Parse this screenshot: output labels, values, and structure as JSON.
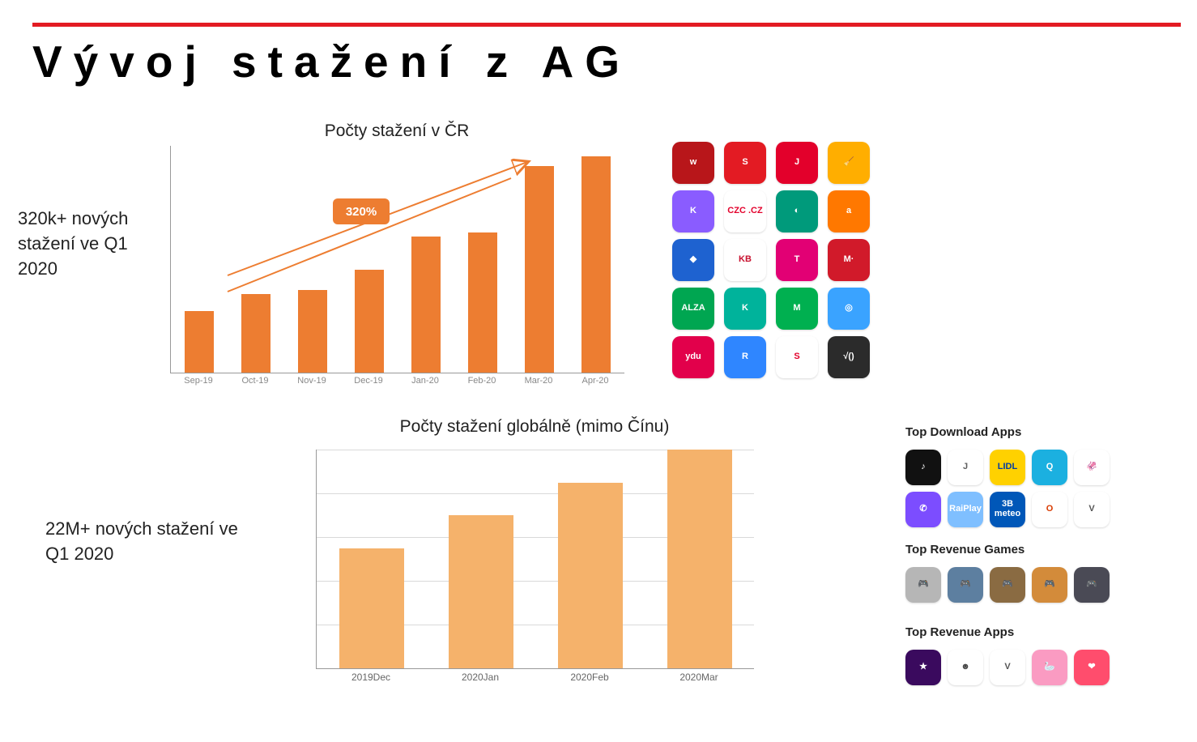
{
  "title": "Vývoj stažení z AG",
  "note1": "320k+ nových stažení ve Q1 2020",
  "note2": "22M+ nových stažení ve Q1 2020",
  "arrow_label": "320%",
  "chart_data": [
    {
      "type": "bar",
      "title": "Počty stažení v ČR",
      "categories": [
        "Sep-19",
        "Oct-19",
        "Nov-19",
        "Dec-19",
        "Jan-20",
        "Feb-20",
        "Mar-20",
        "Apr-20"
      ],
      "values": [
        30,
        38,
        40,
        50,
        66,
        68,
        100,
        105
      ],
      "note": "values are relative; chart has no y-axis tick labels",
      "ylim": [
        0,
        110
      ],
      "annotation": "320% growth arrow from ~Oct-19 to ~Apr-20 region"
    },
    {
      "type": "bar",
      "title": "Počty stažení globálně (mimo Čínu)",
      "categories": [
        "2019Dec",
        "2020Jan",
        "2020Feb",
        "2020Mar"
      ],
      "values": [
        55,
        70,
        85,
        100
      ],
      "note": "values are relative; chart has no y-axis tick labels",
      "ylim": [
        0,
        100
      ]
    }
  ],
  "icon_grid_top": [
    {
      "label": "w",
      "bg": "#b8161a"
    },
    {
      "label": "S",
      "bg": "#e31b23"
    },
    {
      "label": "J",
      "bg": "#e3002b"
    },
    {
      "label": "🧹",
      "bg": "#ffae00"
    },
    {
      "label": "K",
      "bg": "#8a5cff"
    },
    {
      "label": "CZC .CZ",
      "bg": "#ffffff",
      "fg": "#e3002b"
    },
    {
      "label": "◐",
      "bg": "#009a7b"
    },
    {
      "label": "a",
      "bg": "#ff7800"
    },
    {
      "label": "◆",
      "bg": "#1e62d0"
    },
    {
      "label": "KB",
      "bg": "#ffffff",
      "fg": "#c8102e"
    },
    {
      "label": "T",
      "bg": "#e20074"
    },
    {
      "label": "M·",
      "bg": "#d11a2a"
    },
    {
      "label": "ALZA",
      "bg": "#00a651"
    },
    {
      "label": "K",
      "bg": "#00b39b"
    },
    {
      "label": "M",
      "bg": "#00b050"
    },
    {
      "label": "◎",
      "bg": "#3aa3ff"
    },
    {
      "label": "ydu",
      "bg": "#e2004b"
    },
    {
      "label": "R",
      "bg": "#2f86ff"
    },
    {
      "label": "S",
      "bg": "#ffffff",
      "fg": "#e3002b"
    },
    {
      "label": "√()",
      "bg": "#2b2b2b"
    }
  ],
  "sections": {
    "top_download_apps": {
      "label": "Top Download Apps",
      "icons": [
        {
          "label": "♪",
          "bg": "#111"
        },
        {
          "label": "J",
          "bg": "#fff",
          "fg": "#5f5f5f"
        },
        {
          "label": "LIDL",
          "bg": "#ffd100",
          "fg": "#003da5"
        },
        {
          "label": "Q",
          "bg": "#1bb0e0"
        },
        {
          "label": "🦑",
          "bg": "#fff",
          "fg": "#111"
        },
        {
          "label": "✆",
          "bg": "#7c4dff"
        },
        {
          "label": "RaiPlay",
          "bg": "#7fbfff"
        },
        {
          "label": "3B meteo",
          "bg": "#0057b8"
        },
        {
          "label": "O",
          "bg": "#fff",
          "fg": "#d83b01"
        },
        {
          "label": "V",
          "bg": "#fff",
          "fg": "#555"
        }
      ]
    },
    "top_revenue_games": {
      "label": "Top Revenue Games",
      "icons": [
        {
          "label": "🎮",
          "bg": "#b6b6b6"
        },
        {
          "label": "🎮",
          "bg": "#5d7fa0"
        },
        {
          "label": "🎮",
          "bg": "#8a6b42"
        },
        {
          "label": "🎮",
          "bg": "#d38b3a"
        },
        {
          "label": "🎮",
          "bg": "#4a4a55"
        }
      ]
    },
    "top_revenue_apps": {
      "label": "Top Revenue Apps",
      "icons": [
        {
          "label": "★",
          "bg": "#3a0a5e"
        },
        {
          "label": "☻",
          "bg": "#fff",
          "fg": "#444"
        },
        {
          "label": "V",
          "bg": "#fff",
          "fg": "#555"
        },
        {
          "label": "🦢",
          "bg": "#fa9bc2"
        },
        {
          "label": "❤",
          "bg": "#ff4d6d"
        }
      ]
    }
  }
}
